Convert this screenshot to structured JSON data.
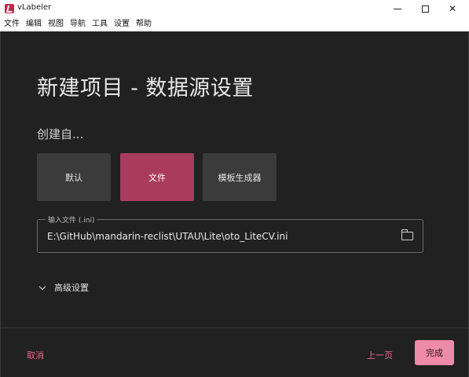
{
  "window": {
    "title": "vLabeler"
  },
  "menu": {
    "items": [
      "文件",
      "编辑",
      "视图",
      "导航",
      "工具",
      "设置",
      "帮助"
    ]
  },
  "page": {
    "heading": "新建项目 - 数据源设置",
    "subheading": "创建自...",
    "options": [
      {
        "label": "默认",
        "selected": false
      },
      {
        "label": "文件",
        "selected": true
      },
      {
        "label": "模板生成器",
        "selected": false
      }
    ],
    "input_file": {
      "label": "输入文件 (.ini)",
      "value": "E:\\GitHub\\mandarin-reclist\\UTAU\\Lite\\oto_LiteCV.ini"
    },
    "advanced": {
      "label": "高级设置"
    }
  },
  "footer": {
    "cancel": "取消",
    "previous": "上一页",
    "done": "完成"
  },
  "colors": {
    "background": "#212121",
    "selected_option": "#a83b5e",
    "accent_text": "#e36b8e",
    "primary_button": "#ee8aaa"
  }
}
